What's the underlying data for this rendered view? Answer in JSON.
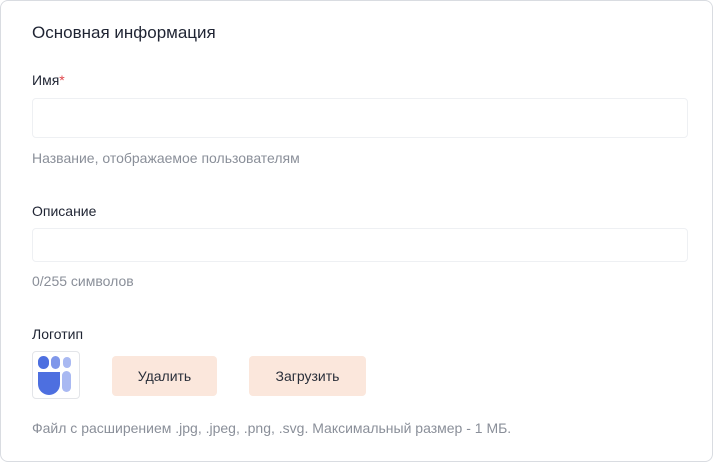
{
  "section": {
    "title": "Основная информация"
  },
  "name_field": {
    "label": "Имя",
    "required_mark": "*",
    "value": "",
    "placeholder": "",
    "hint": "Название, отображаемое пользователям"
  },
  "description_field": {
    "label": "Описание",
    "value": "",
    "placeholder": "",
    "counter": "0/255 символов"
  },
  "logo": {
    "label": "Логотип",
    "icon": "brand-logo-icon",
    "colors": {
      "primary": "#4d6fe0",
      "secondary": "#a9b9f2"
    },
    "delete_label": "Удалить",
    "upload_label": "Загрузить",
    "hint": "Файл с расширением .jpg, .jpeg, .png, .svg. Максимальный размер - 1 МБ."
  },
  "colors": {
    "button_bg": "#fbe7dc",
    "required": "#e0464b",
    "hint_text": "#8a8f99"
  }
}
